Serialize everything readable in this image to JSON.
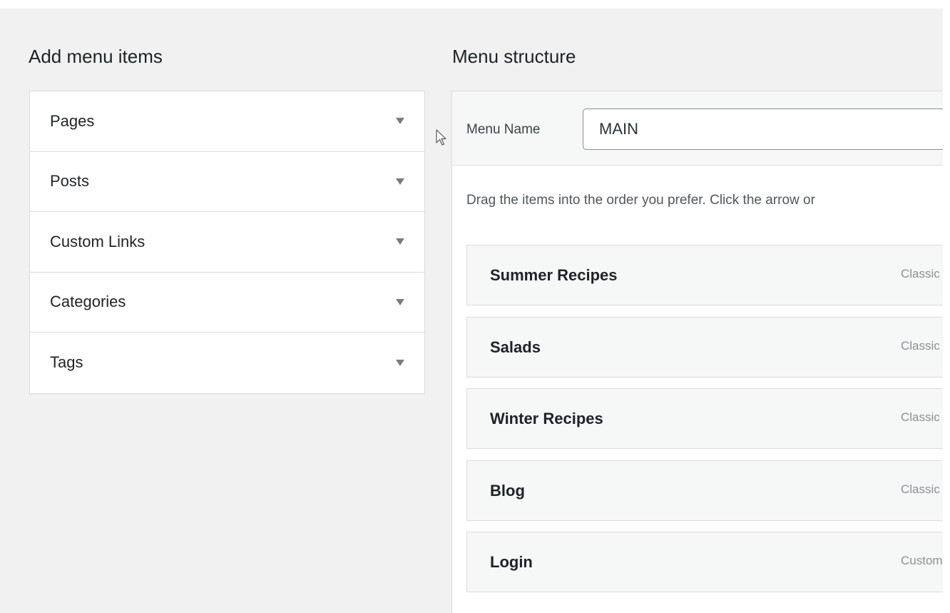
{
  "add_menu_items": {
    "title": "Add menu items",
    "sections": [
      {
        "label": "Pages"
      },
      {
        "label": "Posts"
      },
      {
        "label": "Custom Links"
      },
      {
        "label": "Categories"
      },
      {
        "label": "Tags"
      }
    ]
  },
  "menu_structure": {
    "title": "Menu structure",
    "menu_name_label": "Menu Name",
    "menu_name_value": "MAIN",
    "instructions": "Drag the items into the order you prefer. Click the arrow or",
    "items": [
      {
        "title": "Summer Recipes",
        "type": "Classic"
      },
      {
        "title": "Salads",
        "type": "Classic"
      },
      {
        "title": "Winter Recipes",
        "type": "Classic"
      },
      {
        "title": "Blog",
        "type": "Classic"
      },
      {
        "title": "Login",
        "type": "Custom"
      }
    ]
  },
  "colors": {
    "background": "#f1f1f1",
    "panel": "#ffffff",
    "border": "#dcdcde",
    "text": "#1d2327",
    "muted": "#8c8f94"
  },
  "icons": {
    "accordion_toggle": "triangle-down-icon",
    "pointer": "mouse-pointer-icon"
  }
}
